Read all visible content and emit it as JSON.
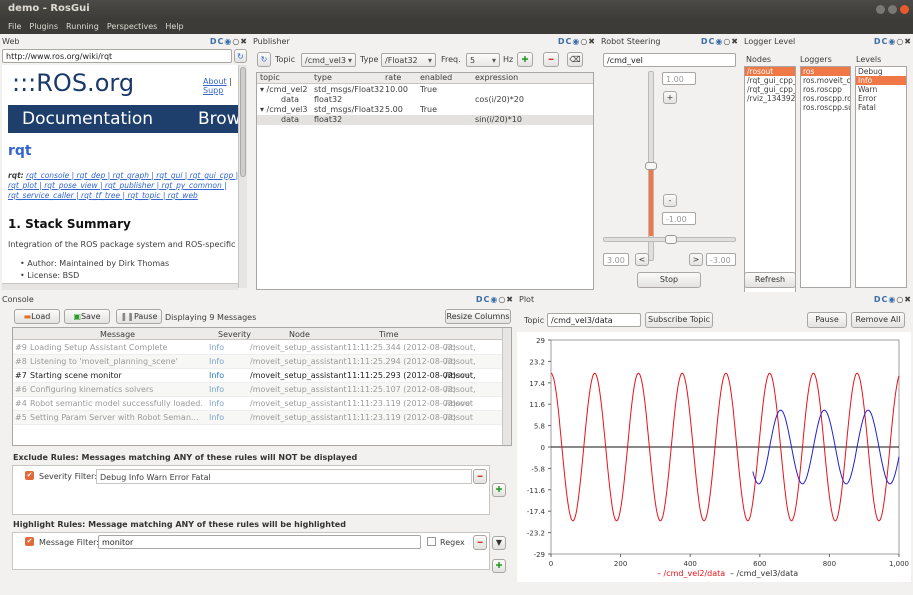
{
  "window": {
    "title": "demo - RosGui"
  },
  "menu": [
    "File",
    "Plugins",
    "Running",
    "Perspectives",
    "Help"
  ],
  "web": {
    "title": "Web",
    "url": "http://www.ros.org/wiki/rqt",
    "logo": ":::ROS.org",
    "about": "About",
    "support": "Supp",
    "nav1": "Documentation",
    "nav2": "Brow",
    "heading": "rqt",
    "links_lead": "rqt:",
    "links": "rqt_console | rqt_dep | rqt_graph | rqt_gui | rqt_gui_cpp | rqt_plot | rqt_pose_view | rqt_publisher | rqt_py_common | rqt_service_caller | rqt_tf_tree | rqt_topic | rqt_web",
    "section": "1. Stack Summary",
    "summary": "Integration of the ROS package system and ROS-specific pl",
    "bullets": [
      "Author: Maintained by Dirk Thomas",
      "License: BSD"
    ]
  },
  "publisher": {
    "title": "Publisher",
    "topic_label": "Topic",
    "topic": "/cmd_vel3",
    "type_label": "Type",
    "type": "/Float32",
    "freq_label": "Freq.",
    "freq": "5",
    "hz": "Hz",
    "columns": [
      "topic",
      "type",
      "rate",
      "enabled",
      "expression"
    ],
    "rows": [
      {
        "topic": "▾ /cmd_vel2",
        "type": "std_msgs/Float32",
        "rate": "10.00",
        "enabled": "True",
        "expression": ""
      },
      {
        "topic": "data",
        "type": "float32",
        "rate": "",
        "enabled": "",
        "expression": "cos(i/20)*20"
      },
      {
        "topic": "▾ /cmd_vel3",
        "type": "std_msgs/Float32",
        "rate": "5.00",
        "enabled": "True",
        "expression": ""
      },
      {
        "topic": "data",
        "type": "float32",
        "rate": "",
        "enabled": "",
        "expression": "sin(i/20)*10"
      }
    ]
  },
  "steering": {
    "title": "Robot Steering",
    "topic": "/cmd_vel",
    "v_max": "1.00",
    "v_min": "-1.00",
    "w_left": "3.00",
    "w_right": "-3.00",
    "stop": "Stop",
    "plus": "+",
    "minus": "-",
    "left": "<",
    "right": ">",
    "v_level": 0.5,
    "w_level": 0.5
  },
  "logger": {
    "title": "Logger Level",
    "nodes_label": "Nodes",
    "loggers_label": "Loggers",
    "levels_label": "Levels",
    "nodes": [
      "/rosout",
      "/rqt_gui_cpp_",
      "/rqt_gui_cpp_",
      "/rviz_134392"
    ],
    "loggers": [
      "ros",
      "ros.moveit_co",
      "ros.roscpp",
      "ros.roscpp.ro",
      "ros.roscpp.su"
    ],
    "levels": [
      "Debug",
      "Info",
      "Warn",
      "Error",
      "Fatal"
    ],
    "selected_level": "Info",
    "refresh": "Refresh"
  },
  "console": {
    "title": "Console",
    "load": "Load",
    "save": "Save",
    "pause": "Pause",
    "count": "Displaying 9 Messages",
    "resize": "Resize Columns",
    "columns": [
      "Message",
      "Severity",
      "Node",
      "Time"
    ],
    "rows": [
      {
        "id": "#9",
        "msg": "Loading Setup Assistant Complete",
        "sev": "Info",
        "node": "/moveit_setup_assistant",
        "time": "11:11:25.344 (2012-08-02)",
        "topics": "/rosout, /move",
        "hl": false
      },
      {
        "id": "#8",
        "msg": "Listening to 'moveit_planning_scene'",
        "sev": "Info",
        "node": "/moveit_setup_assistant",
        "time": "11:11:25.294 (2012-08-02)",
        "topics": "/rosout, /move",
        "hl": false
      },
      {
        "id": "#7",
        "msg": "Starting scene monitor",
        "sev": "Info",
        "node": "/moveit_setup_assistant",
        "time": "11:11:25.293 (2012-08-02)",
        "topics": "/rosout, /move",
        "hl": true
      },
      {
        "id": "#6",
        "msg": "Configuring kinematics solvers",
        "sev": "Info",
        "node": "/moveit_setup_assistant",
        "time": "11:11:25.107 (2012-08-02)",
        "topics": "/rosout, /move",
        "hl": false
      },
      {
        "id": "#4",
        "msg": "Robot semantic model successfully loaded.",
        "sev": "Info",
        "node": "/moveit_setup_assistant",
        "time": "11:11:23.119 (2012-08-02)",
        "topics": "/rosout",
        "hl": false
      },
      {
        "id": "#5",
        "msg": "Setting Param Server with Robot Seman...",
        "sev": "Info",
        "node": "/moveit_setup_assistant",
        "time": "11:11:23.119 (2012-08-02)",
        "topics": "/rosout",
        "hl": false
      }
    ],
    "exclude_title": "Exclude Rules: Messages matching ANY of these rules will NOT be displayed",
    "severity_filter": "Severity Filter:",
    "severities": [
      "Debug",
      "Info",
      "Warn",
      "Error",
      "Fatal"
    ],
    "highlight_title": "Highlight Rules: Message matching ANY of these rules will be highlighted",
    "message_filter": "Message Filter:",
    "message_filter_value": "monitor",
    "regex": "Regex"
  },
  "plot": {
    "title": "Plot",
    "topic_label": "Topic",
    "topic": "/cmd_vel3/data",
    "subscribe": "Subscribe Topic",
    "pause": "Pause",
    "remove_all": "Remove All",
    "legend": [
      "– /cmd_vel2/data",
      "– /cmd_vel3/data"
    ]
  },
  "chart_data": {
    "type": "line",
    "x_range": [
      0,
      1000
    ],
    "y_range": [
      -29,
      29
    ],
    "xticks": [
      "0",
      "200",
      "400",
      "600",
      "800",
      "1,000"
    ],
    "yticks": [
      "29",
      "23.2",
      "17.4",
      "11.6",
      "5.8",
      "0",
      "-5.8",
      "-11.6",
      "-17.4",
      "-23.2",
      "-29"
    ],
    "series": [
      {
        "name": "/cmd_vel2/data",
        "color": "#e8121a",
        "expression": "20*cos(i/20)",
        "x_start": 0,
        "x_end": 1000
      },
      {
        "name": "/cmd_vel3/data",
        "color": "#2020d8",
        "expression": "10*sin(i/20)",
        "x_start": 580,
        "x_end": 1000
      }
    ],
    "zero_line": true
  }
}
